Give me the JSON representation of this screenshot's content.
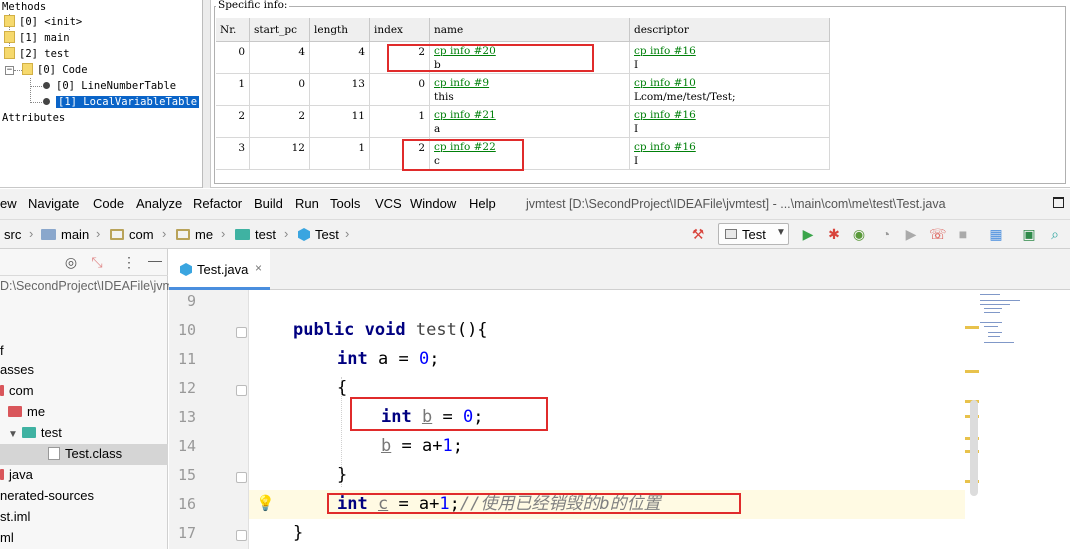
{
  "tree": {
    "methods_label": "Methods",
    "init": "[0] <init>",
    "main": "[1] main",
    "test": "[2] test",
    "code": "[0] Code",
    "line_number_table": "[0] LineNumberTable",
    "local_variable_table": "[1] LocalVariableTable",
    "attributes_label": "Attributes"
  },
  "info": {
    "title": "Specific info:",
    "headers": [
      "Nr.",
      "start_pc",
      "length",
      "index",
      "name",
      "descriptor"
    ],
    "rows": [
      {
        "nr": "0",
        "start_pc": "4",
        "length": "4",
        "index": "2",
        "name_ref": "cp info #20",
        "name": "b",
        "desc_ref": "cp info #16",
        "desc": "I"
      },
      {
        "nr": "1",
        "start_pc": "0",
        "length": "13",
        "index": "0",
        "name_ref": "cp info #9",
        "name": "this",
        "desc_ref": "cp info #10",
        "desc": "Lcom/me/test/Test;"
      },
      {
        "nr": "2",
        "start_pc": "2",
        "length": "11",
        "index": "1",
        "name_ref": "cp info #21",
        "name": "a",
        "desc_ref": "cp info #16",
        "desc": "I"
      },
      {
        "nr": "3",
        "start_pc": "12",
        "length": "1",
        "index": "2",
        "name_ref": "cp info #22",
        "name": "c",
        "desc_ref": "cp info #16",
        "desc": "I"
      }
    ]
  },
  "menubar": {
    "items": [
      "ew",
      "Navigate",
      "Code",
      "Analyze",
      "Refactor",
      "Build",
      "Run",
      "Tools",
      "VCS",
      "Window",
      "Help"
    ],
    "window_title": "jvmtest [D:\\SecondProject\\IDEAFile\\jvmtest] - ...\\main\\com\\me\\test\\Test.java"
  },
  "breadcrumb": [
    "src",
    "main",
    "com",
    "me",
    "test",
    "Test"
  ],
  "run_config": "Test",
  "project": {
    "path": "D:\\SecondProject\\IDEAFile\\jvm",
    "items": [
      "f",
      "asses",
      "com",
      "me",
      "test",
      "Test.class",
      "java",
      "nerated-sources",
      "st.iml",
      "ml"
    ]
  },
  "editor": {
    "tab_label": "Test.java",
    "tab_close": "×",
    "line_numbers": [
      "9",
      "10",
      "11",
      "12",
      "13",
      "14",
      "15",
      "16",
      "17"
    ],
    "code": {
      "l10_kw1": "public",
      "l10_kw2": "void",
      "l10_name": "test",
      "l10_rest": "(){",
      "l11_kw": "int",
      "l11_var": "a",
      "l11_eq": " = ",
      "l11_num": "0",
      "l11_end": ";",
      "l12": "{",
      "l13_kw": "int",
      "l13_var": "b",
      "l13_eq": " = ",
      "l13_num": "0",
      "l13_end": ";",
      "l14_var": "b",
      "l14_rest": " = a+",
      "l14_num": "1",
      "l14_end": ";",
      "l15": "}",
      "l16_kw": "int",
      "l16_var": "c",
      "l16_rest": " = a+",
      "l16_num": "1",
      "l16_end": ";",
      "l16_comment": "//使用已经销毁的b的位置",
      "l17": "}"
    }
  }
}
